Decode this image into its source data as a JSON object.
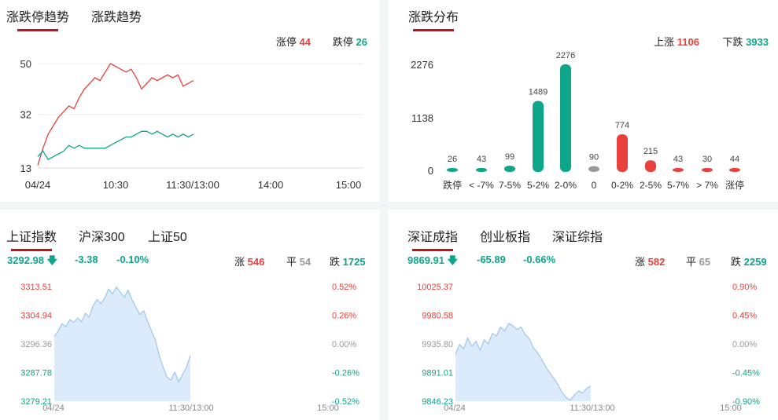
{
  "trend_panel": {
    "tabs": [
      "涨跌停趋势",
      "涨跌趋势"
    ],
    "limit_up_label": "涨停",
    "limit_up_value": "44",
    "limit_down_label": "跌停",
    "limit_down_value": "26",
    "y_ticks": [
      "50",
      "32",
      "13"
    ],
    "x_ticks": [
      "04/24",
      "10:30",
      "11:30/13:00",
      "14:00",
      "15:00"
    ]
  },
  "dist_panel": {
    "title": "涨跌分布",
    "up_label": "上涨",
    "up_value": "1106",
    "down_label": "下跌",
    "down_value": "3933",
    "y_ticks": [
      "2276",
      "1138",
      "0"
    ]
  },
  "sh_panel": {
    "tabs": [
      "上证指数",
      "沪深300",
      "上证50"
    ],
    "price": "3292.98",
    "change": "-3.38",
    "pct": "-0.10%",
    "up_label": "涨",
    "up_value": "546",
    "flat_label": "平",
    "flat_value": "54",
    "down_label": "跌",
    "down_value": "1725",
    "left_ticks": [
      "3313.51",
      "3304.94",
      "3296.36",
      "3287.78",
      "3279.21"
    ],
    "right_ticks": [
      "0.52%",
      "0.26%",
      "0.00%",
      "-0.26%",
      "-0.52%"
    ],
    "x_ticks": [
      "04/24",
      "11:30/13:00",
      "15:00"
    ]
  },
  "sz_panel": {
    "tabs": [
      "深证成指",
      "创业板指",
      "深证综指"
    ],
    "price": "9869.91",
    "change": "-65.89",
    "pct": "-0.66%",
    "up_label": "涨",
    "up_value": "582",
    "flat_label": "平",
    "flat_value": "65",
    "down_label": "跌",
    "down_value": "2259",
    "left_ticks": [
      "10025.37",
      "9980.58",
      "9935.80",
      "9891.01",
      "9846.23"
    ],
    "right_ticks": [
      "0.90%",
      "0.45%",
      "0.00%",
      "-0.45%",
      "-0.90%"
    ],
    "x_ticks": [
      "04/24",
      "11:30/13:00",
      "15:00"
    ]
  },
  "colors": {
    "up": "#e8403a",
    "down": "#0da68a",
    "flat": "#999999",
    "accent": "#c0121c",
    "area": "#dcebfb",
    "area_line": "#9cc6ef"
  },
  "chart_data": [
    {
      "type": "line",
      "xlabel": "",
      "ylabel": "",
      "ylim": [
        13,
        50
      ],
      "x_ticks": [
        "04/24",
        "10:30",
        "11:30/13:00",
        "14:00",
        "15:00"
      ],
      "series": [
        {
          "name": "涨停",
          "color": "#e8403a",
          "values": [
            14,
            20,
            25,
            28,
            31,
            33,
            35,
            34,
            38,
            41,
            43,
            45,
            44,
            47,
            50,
            49,
            48,
            47,
            48,
            45,
            41,
            43,
            45,
            44,
            45,
            46,
            45,
            46,
            42,
            43,
            44
          ]
        },
        {
          "name": "跌停",
          "color": "#0da68a",
          "values": [
            17,
            19,
            16,
            17,
            18,
            19,
            21,
            20,
            21,
            20,
            20,
            20,
            20,
            20,
            21,
            22,
            23,
            24,
            24,
            25,
            26,
            26,
            25,
            26,
            25,
            24,
            25,
            24,
            25,
            24,
            25
          ]
        }
      ]
    },
    {
      "type": "bar",
      "categories": [
        "跌停",
        "< -7%",
        "7-5%",
        "5-2%",
        "2-0%",
        "0",
        "0-2%",
        "2-5%",
        "5-7%",
        "> 7%",
        "涨停"
      ],
      "values": [
        26,
        43,
        99,
        1489,
        2276,
        90,
        774,
        215,
        43,
        30,
        44
      ],
      "ylim": [
        0,
        2276
      ]
    },
    {
      "type": "area",
      "name": "上证指数",
      "ylim": [
        3279.21,
        3313.51
      ],
      "values": [
        3298.5,
        3300.2,
        3302.4,
        3301.5,
        3303.6,
        3302.8,
        3304.1,
        3303.0,
        3305.5,
        3304.4,
        3307.8,
        3309.6,
        3308.4,
        3310.2,
        3312.8,
        3311.3,
        3313.4,
        3311.8,
        3310.3,
        3312.4,
        3309.5,
        3307.3,
        3305.1,
        3306.3,
        3303.1,
        3300.2,
        3297.6,
        3292.8,
        3289.4,
        3286.4,
        3285.5,
        3287.9,
        3285.0,
        3287.2,
        3289.4,
        3292.98
      ]
    },
    {
      "type": "area",
      "name": "深证成指",
      "ylim": [
        9846.23,
        10025.37
      ],
      "values": [
        9920.0,
        9935.0,
        9928.0,
        9945.0,
        9932.0,
        9940.0,
        9926.0,
        9942.0,
        9936.0,
        9952.0,
        9948.0,
        9962.0,
        9956.0,
        9968.0,
        9964.0,
        9958.0,
        9962.0,
        9950.0,
        9944.0,
        9930.0,
        9922.0,
        9912.0,
        9900.0,
        9890.0,
        9882.0,
        9872.0,
        9860.0,
        9852.0,
        9848.0,
        9856.0,
        9862.0,
        9859.0,
        9866.0,
        9869.91
      ]
    }
  ]
}
